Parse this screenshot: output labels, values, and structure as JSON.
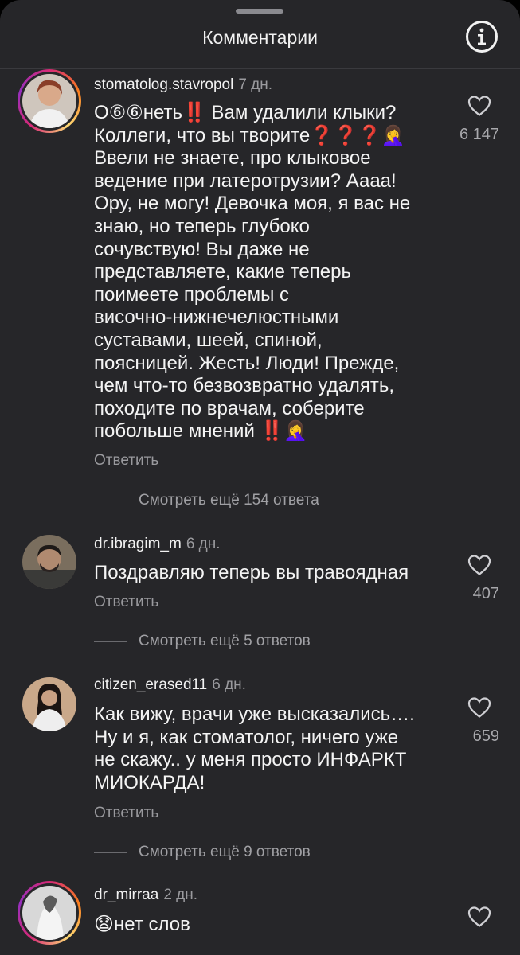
{
  "header": {
    "title": "Комментарии",
    "info_icon": "info-icon"
  },
  "comments": [
    {
      "username": "stomatolog.stavropol",
      "time": "7 дн.",
      "lines": [
        "О⑥⑥неть‼️ Вам удалили клыки?",
        "Коллеги, что вы творите❓❓❓🤦‍♀️",
        "Ввели не знаете, про клыковое",
        "ведение при латеротрузии?  Аааа!",
        "Ору, не могу! Девочка моя, я вас не",
        "знаю, но теперь глубоко",
        "сочувствую! Вы даже не",
        "представляете, какие теперь",
        "поимеете проблемы с",
        "височно-нижнечелюстными",
        "суставами, шеей, спиной,",
        "поясницей. Жесть! Люди! Прежде,",
        "чем что-то  безвозвратно удалять,",
        "походите по врачам, соберите",
        "побольше мнений ‼️🤦‍♀️"
      ],
      "reply": "Ответить",
      "likes": "6 147",
      "view_more": "Смотреть ещё 154 ответа",
      "has_story_ring": true
    },
    {
      "username": "dr.ibragim_m",
      "time": "6 дн.",
      "lines": [
        "Поздравляю теперь вы травоядная"
      ],
      "reply": "Ответить",
      "likes": "407",
      "view_more": "Смотреть ещё 5 ответов",
      "has_story_ring": false
    },
    {
      "username": "citizen_erased11",
      "time": "6 дн.",
      "lines": [
        "Как вижу, врачи уже высказались….",
        "Ну и я, как стоматолог, ничего уже",
        "не скажу.. у меня просто ИНФАРКТ",
        "МИОКАРДА!"
      ],
      "reply": "Ответить",
      "likes": "659",
      "view_more": "Смотреть ещё 9 ответов",
      "has_story_ring": false
    },
    {
      "username": "dr_mirraa",
      "time": "2 дн.",
      "lines": [
        "😧нет слов"
      ],
      "reply": "",
      "likes": "",
      "view_more": "",
      "has_story_ring": true
    }
  ],
  "colors": {
    "background": "#262629",
    "text_secondary": "#9a9a9e",
    "story_ring": "#d62976"
  }
}
